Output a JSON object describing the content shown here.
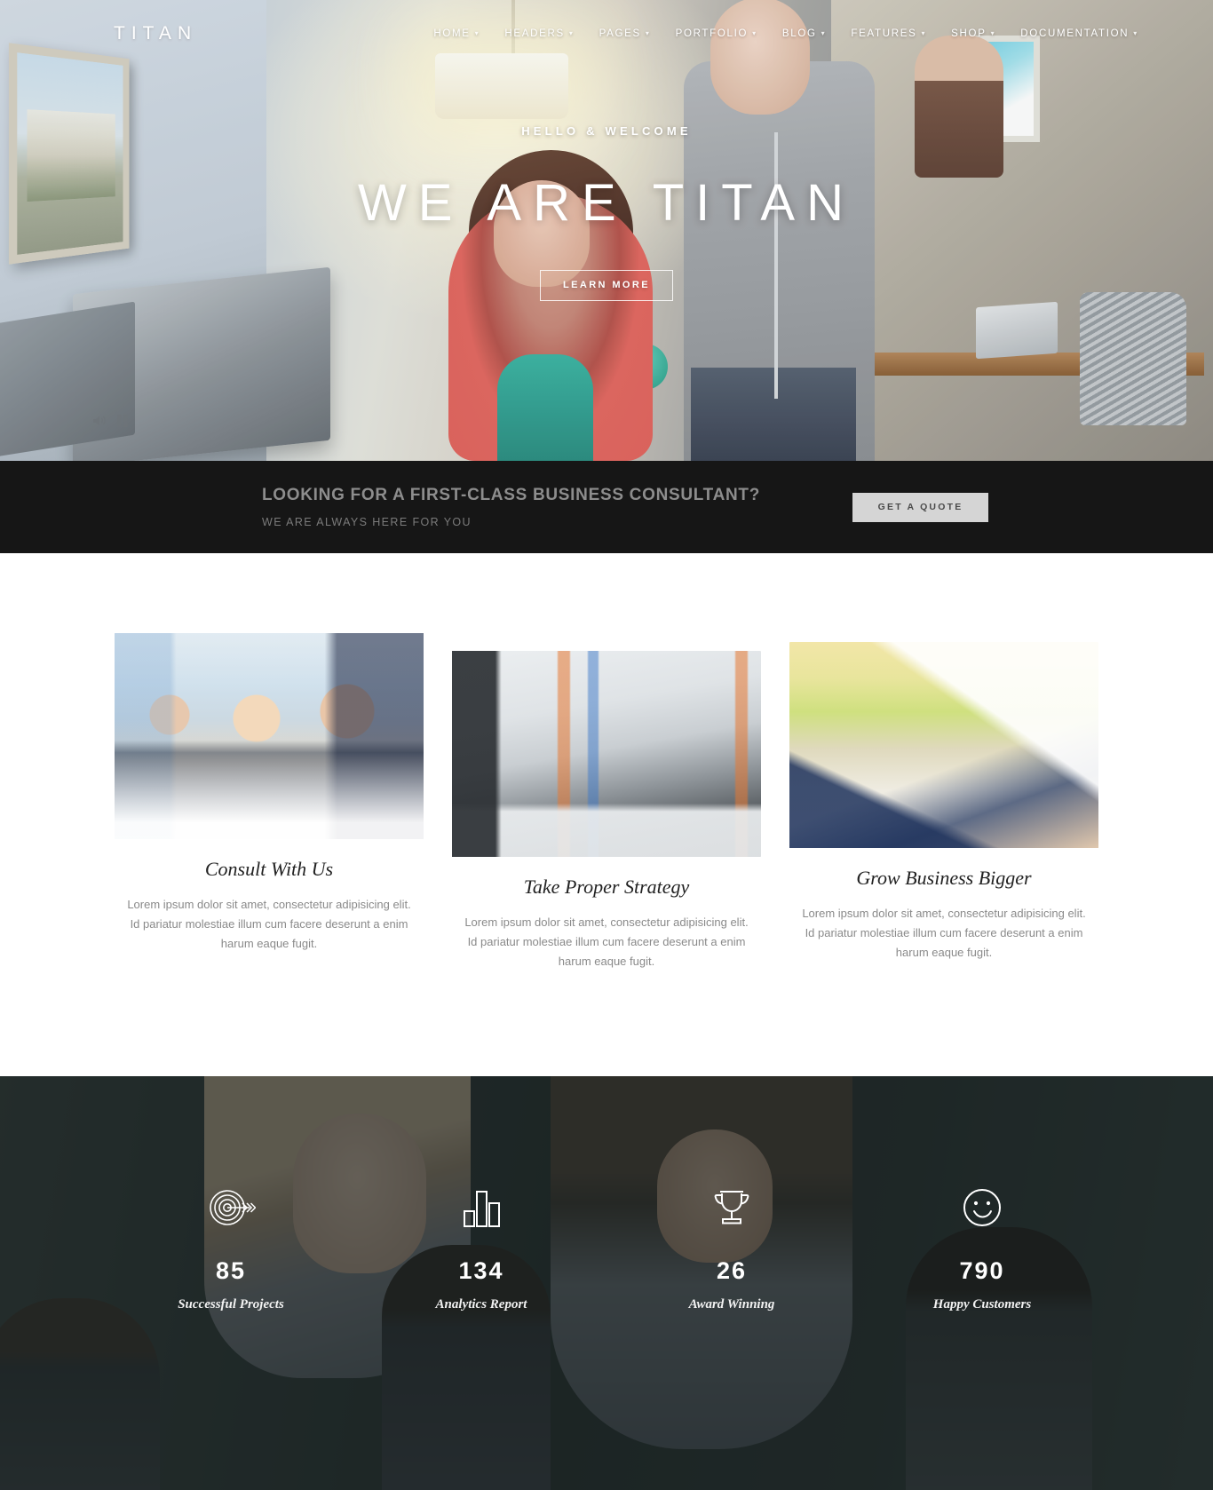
{
  "site": {
    "logo": "TITAN"
  },
  "nav": {
    "items": [
      {
        "label": "HOME",
        "caret": "chevron-down-icon"
      },
      {
        "label": "HEADERS",
        "caret": "chevron-down-icon"
      },
      {
        "label": "PAGES",
        "caret": "chevron-down-icon"
      },
      {
        "label": "PORTFOLIO",
        "caret": "chevron-down-icon"
      },
      {
        "label": "BLOG",
        "caret": "chevron-down-icon"
      },
      {
        "label": "FEATURES",
        "caret": "chevron-down-icon"
      },
      {
        "label": "SHOP",
        "caret": "chevron-down-icon"
      },
      {
        "label": "DOCUMENTATION",
        "caret": "chevron-down-icon"
      }
    ]
  },
  "hero": {
    "eyebrow": "HELLO & WELCOME",
    "title": "WE ARE TITAN",
    "button": "LEARN MORE",
    "video_controls": {
      "volume": "volume-icon",
      "pause": "pause-icon"
    }
  },
  "cta": {
    "heading": "LOOKING FOR A FIRST-CLASS BUSINESS CONSULTANT?",
    "subheading": "WE ARE ALWAYS HERE FOR YOU",
    "button": "GET A QUOTE",
    "bg_color": "#161616",
    "button_bg": "#d5d5d5"
  },
  "services": {
    "cards": [
      {
        "image": "business-meeting-photo",
        "title": "Consult With Us",
        "desc": "Lorem ipsum dolor sit amet, consectetur adipisicing elit. Id pariatur molestiae illum cum facere deserunt a enim harum eaque fugit."
      },
      {
        "image": "laptop-charts-photo",
        "title": "Take Proper Strategy",
        "desc": "Lorem ipsum dolor sit amet, consectetur adipisicing elit. Id pariatur molestiae illum cum facere deserunt a enim harum eaque fugit."
      },
      {
        "image": "reports-review-photo",
        "title": "Grow Business Bigger",
        "desc": "Lorem ipsum dolor sit amet, consectetur adipisicing elit. Id pariatur molestiae illum cum facere deserunt a enim harum eaque fugit."
      }
    ]
  },
  "counters": {
    "items": [
      {
        "icon": "target-arrow-icon",
        "value": "85",
        "label": "Successful Projects"
      },
      {
        "icon": "bar-chart-icon",
        "value": "134",
        "label": "Analytics Report"
      },
      {
        "icon": "trophy-icon",
        "value": "26",
        "label": "Award Winning"
      },
      {
        "icon": "smiley-face-icon",
        "value": "790",
        "label": "Happy Customers"
      }
    ]
  }
}
